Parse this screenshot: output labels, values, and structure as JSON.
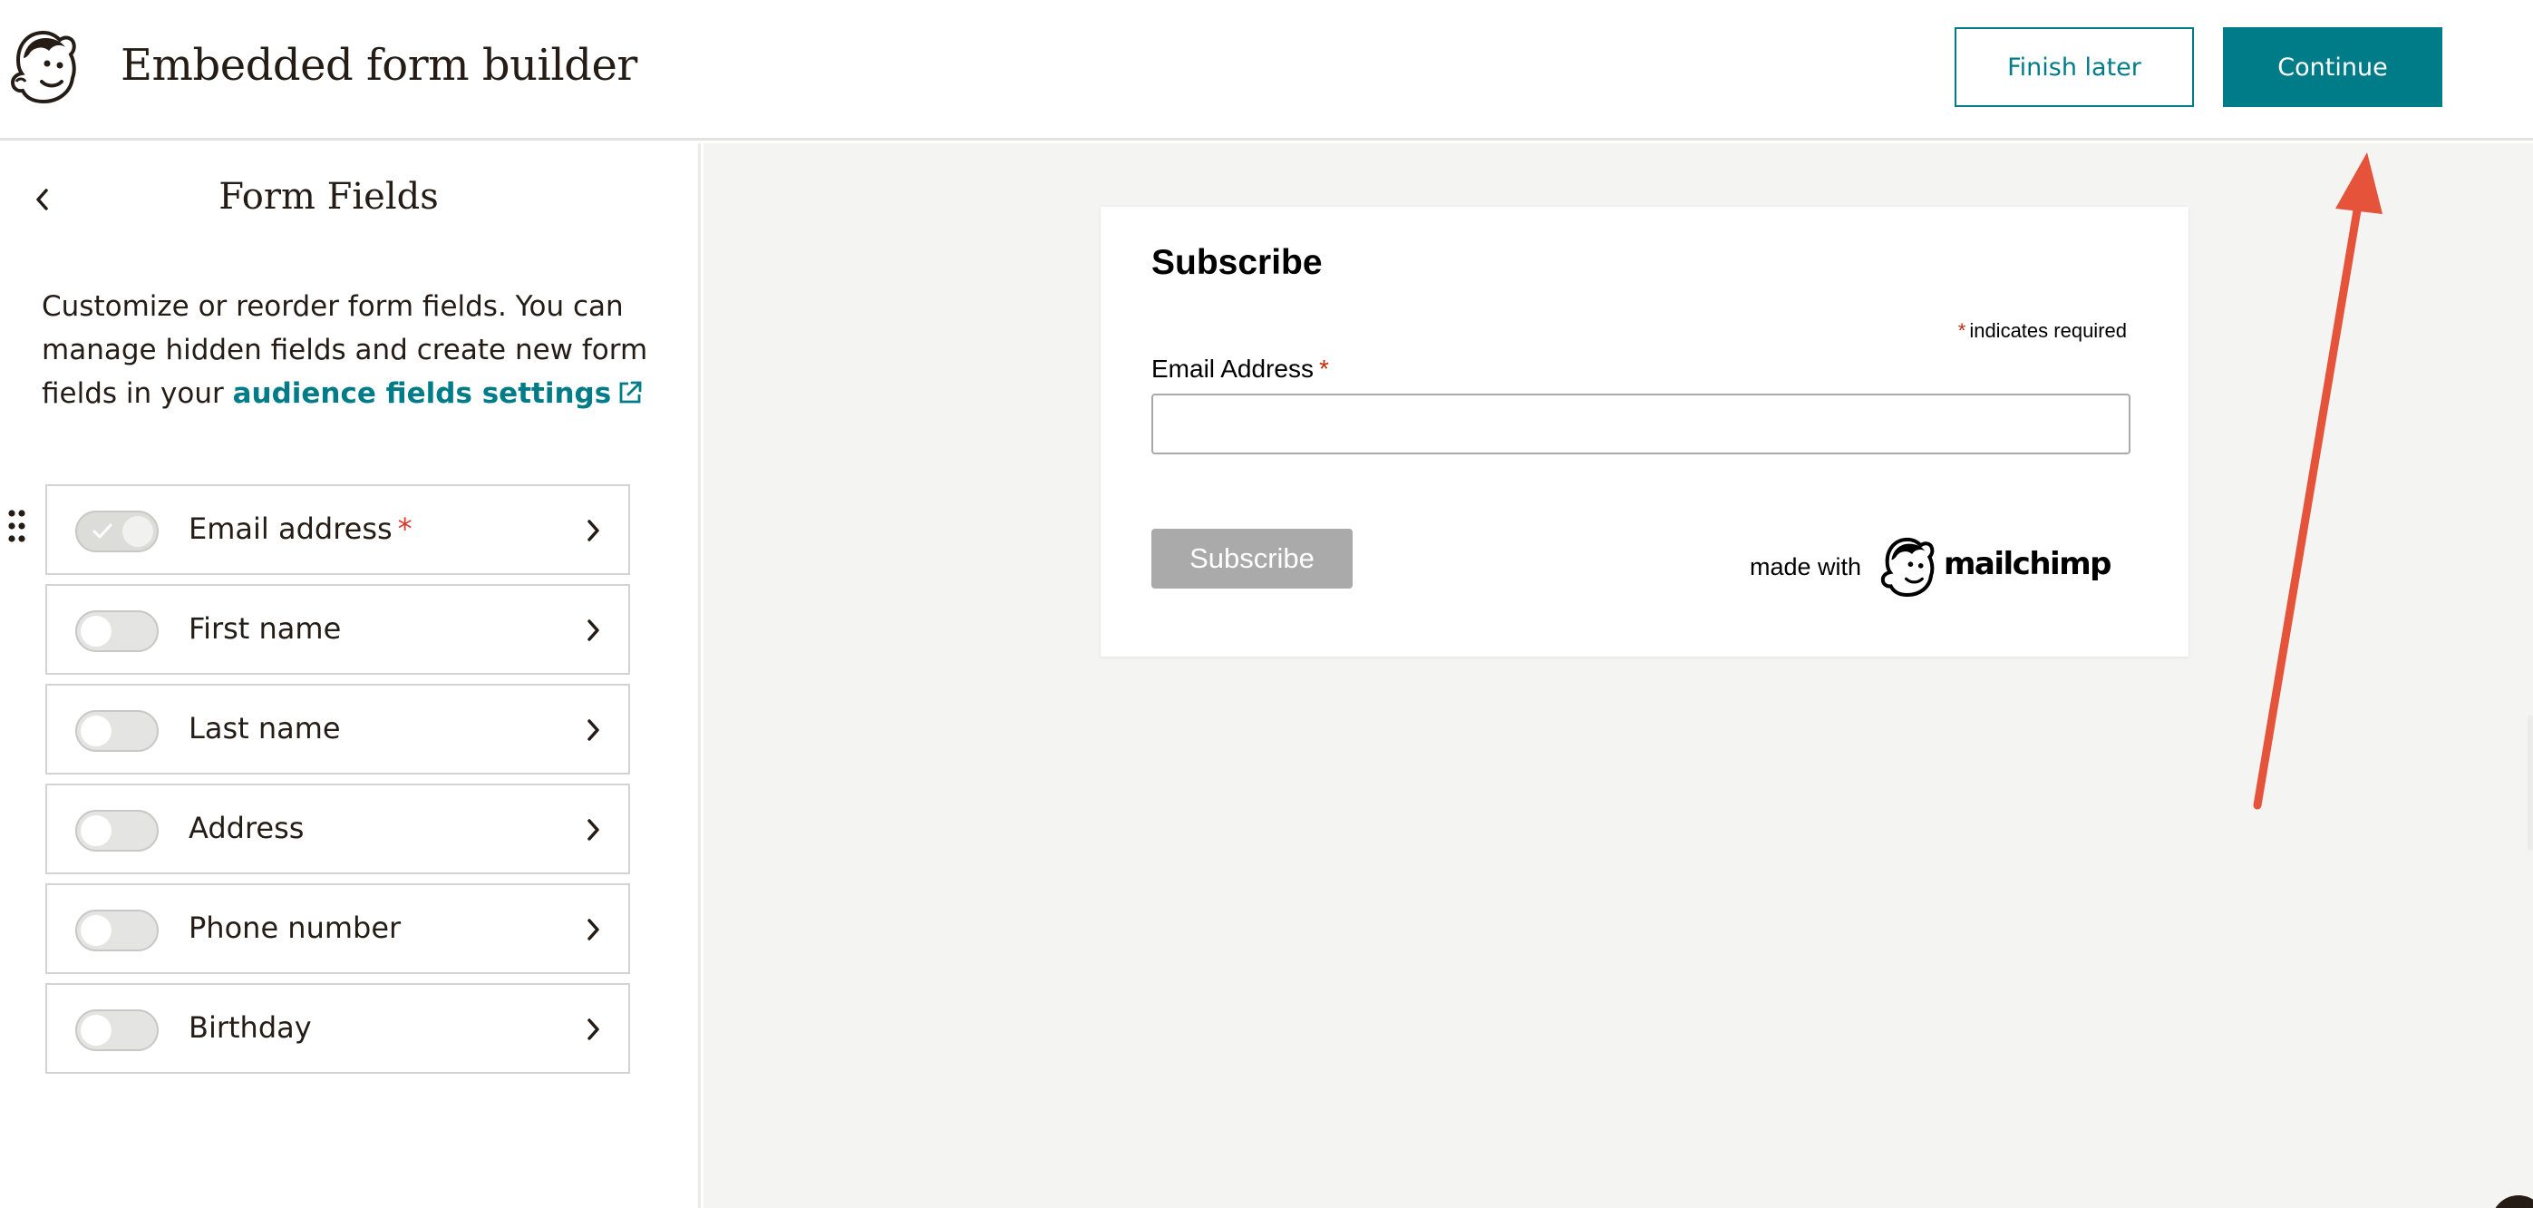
{
  "header": {
    "title": "Embedded form builder",
    "finish_later_label": "Finish later",
    "continue_label": "Continue"
  },
  "sidebar": {
    "title": "Form Fields",
    "description_prefix": "Customize or reorder form fields. You can manage hidden fields and create new form fields in your ",
    "settings_link": "audience fields settings",
    "fields": [
      {
        "label": "Email address",
        "required": true,
        "enabled": true
      },
      {
        "label": "First name",
        "required": false,
        "enabled": false
      },
      {
        "label": "Last name",
        "required": false,
        "enabled": false
      },
      {
        "label": "Address",
        "required": false,
        "enabled": false
      },
      {
        "label": "Phone number",
        "required": false,
        "enabled": false
      },
      {
        "label": "Birthday",
        "required": false,
        "enabled": false
      }
    ],
    "required_marker": "*"
  },
  "preview": {
    "form_title": "Subscribe",
    "required_marker": "*",
    "required_note": "indicates required",
    "email_label": "Email Address",
    "email_placeholder": "",
    "subscribe_label": "Subscribe",
    "made_with": "made with",
    "brand_wordmark": "mailchimp"
  },
  "colors": {
    "brand_teal": "#007c89",
    "required_red": "#d73a2d",
    "annotation_arrow": "#e5533a",
    "preview_bg": "#f4f4f2"
  }
}
